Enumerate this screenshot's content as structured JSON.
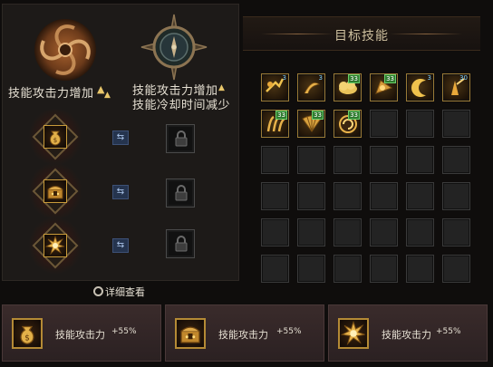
{
  "left_panel": {
    "option_a": {
      "line1": "技能攻击力增加"
    },
    "option_b": {
      "line1": "技能攻击力增加",
      "line2": "技能冷却时间减少"
    },
    "swap_symbol": "⇆",
    "detail_link": "详细查看",
    "rows": [
      {
        "icon": "money-bag-icon"
      },
      {
        "icon": "treasure-chest-icon"
      },
      {
        "icon": "explosion-icon"
      }
    ]
  },
  "right_panel": {
    "title": "目标技能",
    "skills": [
      {
        "icon": "dash-strike-icon",
        "badge": "3",
        "badge_style": "num"
      },
      {
        "icon": "whirlwind-icon",
        "badge": "3",
        "badge_style": "num"
      },
      {
        "icon": "cloud-burst-icon",
        "badge": "33",
        "badge_style": "green"
      },
      {
        "icon": "horn-icon",
        "badge": "33",
        "badge_style": "green"
      },
      {
        "icon": "crescent-slash-icon",
        "badge": "3",
        "badge_style": "num"
      },
      {
        "icon": "rising-strike-icon",
        "badge": "30",
        "badge_style": "num"
      },
      {
        "icon": "claw-icon",
        "badge": "33",
        "badge_style": "green"
      },
      {
        "icon": "fan-icon",
        "badge": "33",
        "badge_style": "green"
      },
      {
        "icon": "spiral-icon",
        "badge": "33",
        "badge_style": "green"
      }
    ],
    "empty_slots": 27
  },
  "bottom_cards": [
    {
      "icon": "money-bag-icon",
      "label": "技能攻击力",
      "value": "+55%"
    },
    {
      "icon": "treasure-chest-icon",
      "label": "技能攻击力",
      "value": "+55%"
    },
    {
      "icon": "explosion-icon",
      "label": "技能攻击力",
      "value": "+55%"
    }
  ],
  "colors": {
    "gold": "#c99b3a",
    "panel": "#1d1a18",
    "swap_blue": "#25344e",
    "card_bg": "#3a2b2b"
  }
}
